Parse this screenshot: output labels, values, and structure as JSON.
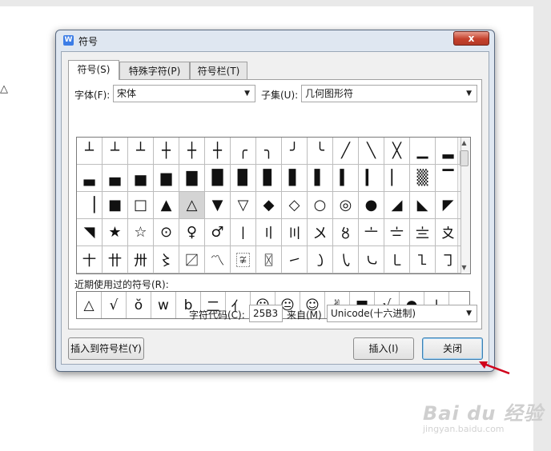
{
  "background_doc": {
    "glyph": "△"
  },
  "dialog": {
    "title": "符号",
    "title_icon": "W",
    "close_glyph": "x",
    "tabs": [
      {
        "label": "符号(S)",
        "active": true
      },
      {
        "label": "特殊字符(P)",
        "active": false
      },
      {
        "label": "符号栏(T)",
        "active": false
      }
    ],
    "font_label": "字体(F):",
    "font_value": "宋体",
    "subset_label": "子集(U):",
    "subset_value": "几何图形符",
    "symbol_grid": [
      [
        "┴",
        "┴",
        "┴",
        "┼",
        "┼",
        "┼",
        "╭",
        "╮",
        "╯",
        "╰",
        "╱",
        "╲",
        "╳",
        "▁",
        "▂"
      ],
      [
        "▃",
        "▄",
        "▅",
        "▆",
        "▇",
        "█",
        "▉",
        "▊",
        "▋",
        "▌",
        "▍",
        "▎",
        "▏",
        "▒",
        "▔"
      ],
      [
        "▕",
        "■",
        "□",
        "▲",
        "△",
        "▼",
        "▽",
        "◆",
        "◇",
        "○",
        "◎",
        "●",
        "◢",
        "◣",
        "◤"
      ],
      [
        "◥",
        "★",
        "☆",
        "⊙",
        "♀",
        "♂",
        "〡",
        "〢",
        "〣",
        "〤",
        "〥",
        "〦",
        "〧",
        "〨",
        "〩"
      ],
      [
        "〸",
        "〹",
        "〺",
        "〻",
        "〼",
        "〽",
        "〾",
        "〿",
        "㇀",
        "㇁",
        "㇂",
        "㇃",
        "㇄",
        "㇅",
        "㇆"
      ]
    ],
    "selected_row": 2,
    "selected_col": 4,
    "recent_label": "近期使用过的符号(R):",
    "recent_symbols": [
      "△",
      "√",
      "ŏ",
      "w",
      "b",
      "二",
      "亻",
      "☹",
      "😐",
      "☺",
      "✌",
      "■",
      "√",
      "●",
      "↓"
    ],
    "char_code_label": "字符代码(C):",
    "char_code_value": "25B3",
    "from_label": "来自(M)",
    "from_value": "Unicode(十六进制)",
    "buttons": {
      "insert_to_bar": "插入到符号栏(Y)",
      "insert": "插入(I)",
      "close": "关闭"
    },
    "icons": {
      "dropdown": "▼",
      "scroll_up": "▲",
      "scroll_down": "▼"
    }
  },
  "watermark": {
    "text": "Bai du 经验",
    "url": "jingyan.baidu.com"
  },
  "colors": {
    "annotation_arrow": "#d0021b",
    "accent": "#3c7fb1"
  }
}
